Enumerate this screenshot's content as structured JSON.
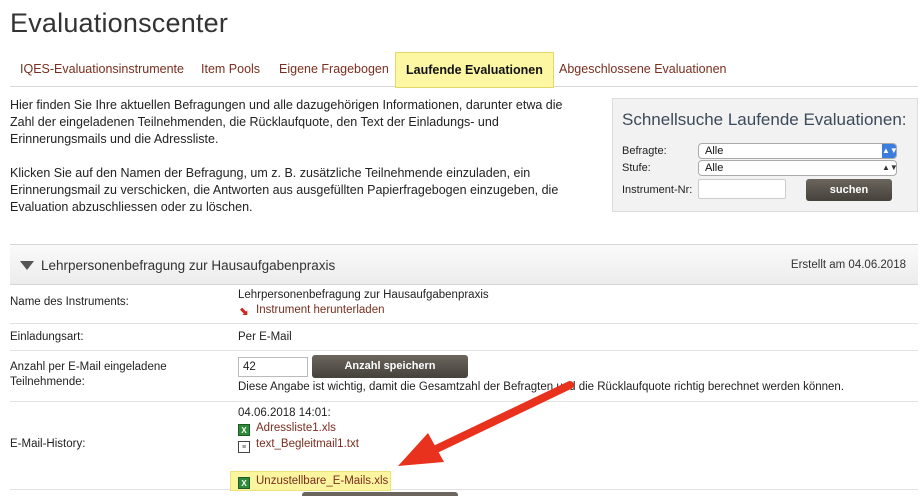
{
  "page_title": "Evaluationscenter",
  "tabs": [
    {
      "label": "IQES-Evaluationsinstrumente",
      "active": false
    },
    {
      "label": "Item Pools",
      "active": false
    },
    {
      "label": "Eigene Fragebogen",
      "active": false
    },
    {
      "label": "Laufende Evaluationen",
      "active": true
    },
    {
      "label": "Abgeschlossene Evaluationen",
      "active": false
    }
  ],
  "intro": {
    "paragraph1": "Hier finden Sie Ihre aktuellen Befragungen und alle dazugehörigen Informationen, darunter etwa die Zahl der eingeladenen Teilnehmenden, die Rücklaufquote, den Text der Einladungs- und Erinnerungsmails und die Adressliste.",
    "paragraph2": "Klicken Sie auf den Namen der Befragung, um z. B. zusätzliche Teilnehmende einzuladen, ein Erinnerungsmail zu verschicken, die Antworten aus ausgefüllten Papierfragebogen einzugeben, die Evaluation abzuschliessen oder zu löschen."
  },
  "quick_search": {
    "title": "Schnellsuche Laufende Evaluationen:",
    "befragte_label": "Befragte:",
    "befragte_value": "Alle",
    "stufe_label": "Stufe:",
    "stufe_value": "Alle",
    "instrument_label": "Instrument-Nr:",
    "instrument_value": "",
    "search_button": "suchen"
  },
  "evaluation": {
    "title": "Lehrpersonenbefragung zur Hausaufgabenpraxis",
    "created": "Erstellt am 04.06.2018",
    "instrument_label": "Name des Instruments:",
    "instrument_name": "Lehrpersonenbefragung zur Hausaufgabenpraxis",
    "instrument_download": "Instrument herunterladen",
    "invitation_label": "Einladungsart:",
    "invitation_value": "Per E-Mail",
    "count_label_line1": "Anzahl per E-Mail eingeladene",
    "count_label_line2": "Teilnehmende:",
    "count_value": "42",
    "count_button": "Anzahl speichern",
    "count_note": "Diese Angabe ist wichtig, damit die Gesamtzahl der Befragten und die Rücklaufquote richtig berechnet werden können.",
    "history_label": "E-Mail-History:",
    "history_timestamp": "04.06.2018 14:01:",
    "history_files": [
      {
        "name": "Adressliste1.xls",
        "icon": "excel-icon"
      },
      {
        "name": "text_Begleitmail1.txt",
        "icon": "text-file-icon"
      },
      {
        "name": "Unzustellbare_E-Mails.xls",
        "icon": "excel-icon"
      }
    ]
  },
  "colors": {
    "active_tab": "#fdf6a3",
    "link": "#7a2e1e",
    "annotation_arrow": "#e8321e",
    "button": "#55504a"
  }
}
